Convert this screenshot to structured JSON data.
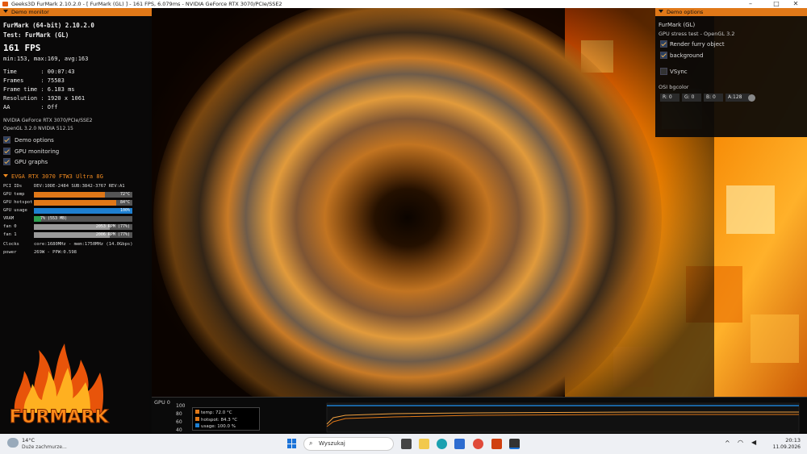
{
  "window": {
    "title": "Geeks3D FurMark 2.10.2.0 - [ FurMark (GL) ] - 161 FPS, 6.079ms - NVIDIA GeForce RTX 3070/PCIe/SSE2",
    "minimize": "–",
    "maximize": "□",
    "close": "✕"
  },
  "demo_monitor": {
    "header": "Demo monitor",
    "app_line": "FurMark (64-bit) 2.10.2.0",
    "test_line": "Test: FurMark (GL)",
    "fps": "161 FPS",
    "fps_stats": "min:153, max:169, avg:163",
    "stats": [
      {
        "label": "Time       ",
        "value": ": 00:07:43"
      },
      {
        "label": "Frames     ",
        "value": ": 75583"
      },
      {
        "label": "Frame time ",
        "value": ": 6.183 ms"
      },
      {
        "label": "Resolution ",
        "value": ": 1920 x 1061"
      },
      {
        "label": "AA         ",
        "value": ": Off"
      }
    ],
    "renderer": "NVIDIA GeForce RTX 3070/PCIe/SSE2",
    "opengl": "OpenGL 3.2.0 NVIDIA 512.15",
    "options": [
      {
        "label": "Demo options",
        "checked": true
      },
      {
        "label": "GPU monitoring",
        "checked": true
      },
      {
        "label": "GPU graphs",
        "checked": true
      }
    ],
    "gpu": {
      "name": "EVGA RTX 3070 FTW3 Ultra 8G",
      "pci_label": "PCI IDs",
      "pci_value": "DEV:10DE-2484 SUB:3842-3767 REV:A1",
      "bars": [
        {
          "label": "GPU temp",
          "text": "72°C",
          "fraction": 0.72,
          "color": "#e07818"
        },
        {
          "label": "GPU hotspot",
          "text": "84°C",
          "fraction": 0.84,
          "color": "#e07818"
        },
        {
          "label": "GPU usage",
          "text": "100%",
          "fraction": 1.0,
          "color": "#1e7fd0"
        },
        {
          "label": "VRAM",
          "text": "7% (553 MB)",
          "fraction": 0.07,
          "color": "#2ea050"
        },
        {
          "label": "fan 0",
          "text": "2053 RPM (77%)",
          "fraction": 0.77,
          "color": "#9a9a9a"
        },
        {
          "label": "fan 1",
          "text": "2006 RPM (77%)",
          "fraction": 0.77,
          "color": "#9a9a9a"
        }
      ],
      "clocks_label": "Clocks",
      "clocks_value": "core:1680MHz - mem:1750MHz (14.0Gbps)",
      "power_label": "power",
      "power_value": "269W - PPW:0.598"
    }
  },
  "logo_text": "FURMARK",
  "demo_options": {
    "header": "Demo options",
    "demo_name": "FurMark (GL)",
    "demo_desc": "GPU stress test - OpenGL 3.2",
    "checks": [
      {
        "label": "Render furry object",
        "checked": true
      },
      {
        "label": "background",
        "checked": true
      },
      {
        "label": "VSync",
        "checked": false
      }
    ],
    "osi_label": "OSI bgcolor",
    "channels": [
      "R: 0",
      "G: 0",
      "B: 0",
      "A:128"
    ]
  },
  "graph": {
    "gpu_label": "GPU 0",
    "yticks": [
      "100",
      "80",
      "60",
      "40"
    ],
    "legend": [
      {
        "label": "temp: 72.0 °C",
        "color": "#e07818"
      },
      {
        "label": "hotspot: 84.3 °C",
        "color": "#e07818"
      },
      {
        "label": "usage: 100.0 %",
        "color": "#1e7fd0"
      }
    ]
  },
  "taskbar": {
    "temperature": "14°C",
    "weather": "Duże zachmurze...",
    "search_placeholder": "Wyszukaj",
    "time": "20:13",
    "date": "11.09.2026"
  }
}
